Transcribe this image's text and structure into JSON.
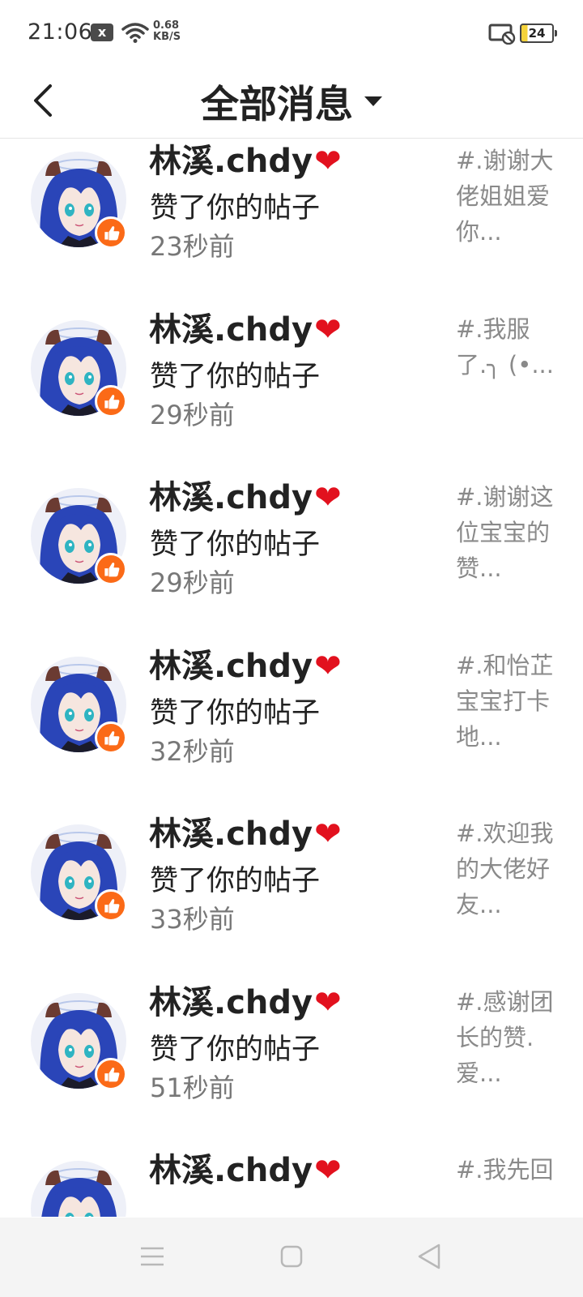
{
  "status_bar": {
    "time": "21:06",
    "notification_icon": "x",
    "speed_value": "0.68",
    "speed_unit": "KB/S",
    "battery": "24"
  },
  "header": {
    "title": "全部消息"
  },
  "notifications": [
    {
      "user": "林溪.chdy",
      "heart": "❤",
      "action": "赞了你的帖子",
      "time": "23秒前",
      "preview": [
        "#.谢谢大",
        "佬姐姐爱",
        "你..."
      ]
    },
    {
      "user": "林溪.chdy",
      "heart": "❤",
      "action": "赞了你的帖子",
      "time": "29秒前",
      "preview": [
        "#.我服",
        "了.╮ (•...",
        ""
      ]
    },
    {
      "user": "林溪.chdy",
      "heart": "❤",
      "action": "赞了你的帖子",
      "time": "29秒前",
      "preview": [
        "#.谢谢这",
        "位宝宝的",
        "赞..."
      ]
    },
    {
      "user": "林溪.chdy",
      "heart": "❤",
      "action": "赞了你的帖子",
      "time": "32秒前",
      "preview": [
        "#.和怡芷",
        "宝宝打卡",
        "地..."
      ]
    },
    {
      "user": "林溪.chdy",
      "heart": "❤",
      "action": "赞了你的帖子",
      "time": "33秒前",
      "preview": [
        "#.欢迎我",
        "的大佬好",
        "友..."
      ]
    },
    {
      "user": "林溪.chdy",
      "heart": "❤",
      "action": "赞了你的帖子",
      "time": "51秒前",
      "preview": [
        "#.感谢团",
        "长的赞.",
        "爱..."
      ]
    },
    {
      "user": "林溪.chdy",
      "heart": "❤",
      "action": "",
      "time": "",
      "preview": [
        "#.我先回",
        "",
        ""
      ]
    }
  ],
  "colors": {
    "like_badge": "#fb6a17",
    "heart": "#e2111e",
    "avatar_hair": "#2a45b8"
  }
}
